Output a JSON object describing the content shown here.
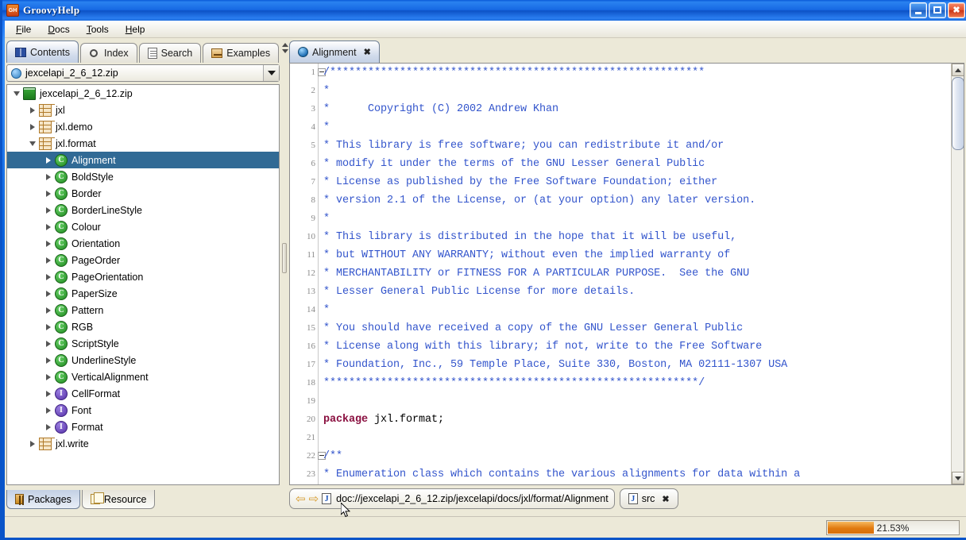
{
  "window": {
    "title": "GroovyHelp",
    "app_icon": "gh-icon",
    "minimize_label": "Minimize",
    "maximize_label": "Maximize",
    "close_label": "Close"
  },
  "menubar": {
    "items": [
      {
        "name": "file",
        "mnemonic": "F",
        "rest": "ile"
      },
      {
        "name": "docs",
        "mnemonic": "D",
        "rest": "ocs"
      },
      {
        "name": "tools",
        "mnemonic": "T",
        "rest": "ools"
      },
      {
        "name": "help",
        "mnemonic": "H",
        "rest": "elp"
      }
    ]
  },
  "left_panel": {
    "tabs": [
      {
        "label": "Contents",
        "icon": "book-icon",
        "selected": true
      },
      {
        "label": "Index",
        "icon": "magnifier-icon",
        "selected": false
      },
      {
        "label": "Search",
        "icon": "search-document-icon",
        "selected": false
      },
      {
        "label": "Examples",
        "icon": "drawer-icon",
        "selected": false
      }
    ],
    "combo": {
      "value": "jexcelapi_2_6_12.zip",
      "icon": "zip-icon"
    },
    "tree": [
      {
        "label": "jexcelapi_2_6_12.zip",
        "depth": 0,
        "icon": "archive-icon",
        "state": "expanded",
        "selected": false
      },
      {
        "label": "jxl",
        "depth": 1,
        "icon": "package-icon",
        "state": "collapsed",
        "selected": false
      },
      {
        "label": "jxl.demo",
        "depth": 1,
        "icon": "package-icon",
        "state": "collapsed",
        "selected": false
      },
      {
        "label": "jxl.format",
        "depth": 1,
        "icon": "package-icon",
        "state": "expanded",
        "selected": false
      },
      {
        "label": "Alignment",
        "depth": 2,
        "icon": "class-icon",
        "state": "collapsed",
        "selected": true
      },
      {
        "label": "BoldStyle",
        "depth": 2,
        "icon": "class-icon",
        "state": "collapsed",
        "selected": false
      },
      {
        "label": "Border",
        "depth": 2,
        "icon": "class-icon",
        "state": "collapsed",
        "selected": false
      },
      {
        "label": "BorderLineStyle",
        "depth": 2,
        "icon": "class-icon",
        "state": "collapsed",
        "selected": false
      },
      {
        "label": "Colour",
        "depth": 2,
        "icon": "class-icon",
        "state": "collapsed",
        "selected": false
      },
      {
        "label": "Orientation",
        "depth": 2,
        "icon": "class-icon",
        "state": "collapsed",
        "selected": false
      },
      {
        "label": "PageOrder",
        "depth": 2,
        "icon": "class-icon",
        "state": "collapsed",
        "selected": false
      },
      {
        "label": "PageOrientation",
        "depth": 2,
        "icon": "class-icon",
        "state": "collapsed",
        "selected": false
      },
      {
        "label": "PaperSize",
        "depth": 2,
        "icon": "class-icon",
        "state": "collapsed",
        "selected": false
      },
      {
        "label": "Pattern",
        "depth": 2,
        "icon": "class-icon",
        "state": "collapsed",
        "selected": false
      },
      {
        "label": "RGB",
        "depth": 2,
        "icon": "class-icon",
        "state": "collapsed",
        "selected": false
      },
      {
        "label": "ScriptStyle",
        "depth": 2,
        "icon": "class-icon",
        "state": "collapsed",
        "selected": false
      },
      {
        "label": "UnderlineStyle",
        "depth": 2,
        "icon": "class-icon",
        "state": "collapsed",
        "selected": false
      },
      {
        "label": "VerticalAlignment",
        "depth": 2,
        "icon": "class-icon",
        "state": "collapsed",
        "selected": false
      },
      {
        "label": "CellFormat",
        "depth": 2,
        "icon": "interface-icon",
        "state": "collapsed",
        "selected": false
      },
      {
        "label": "Font",
        "depth": 2,
        "icon": "interface-icon",
        "state": "collapsed",
        "selected": false
      },
      {
        "label": "Format",
        "depth": 2,
        "icon": "interface-icon",
        "state": "collapsed",
        "selected": false
      },
      {
        "label": "jxl.write",
        "depth": 1,
        "icon": "package-icon",
        "state": "collapsed",
        "selected": false
      }
    ],
    "bottom_tabs": [
      {
        "label": "Packages",
        "icon": "packages-icon",
        "selected": true
      },
      {
        "label": "Resource",
        "icon": "resource-icon",
        "selected": false
      }
    ]
  },
  "editor": {
    "tabs": [
      {
        "label": "Alignment",
        "icon": "globe-icon",
        "selected": true,
        "close": "✖"
      }
    ],
    "lines": [
      {
        "n": "1",
        "fold": true,
        "text": "/***********************************************************",
        "type": "comment"
      },
      {
        "n": "2",
        "fold": false,
        "text": "*",
        "type": "comment"
      },
      {
        "n": "3",
        "fold": false,
        "text": "*      Copyright (C) 2002 Andrew Khan",
        "type": "comment"
      },
      {
        "n": "4",
        "fold": false,
        "text": "*",
        "type": "comment"
      },
      {
        "n": "5",
        "fold": false,
        "text": "* This library is free software; you can redistribute it and/or",
        "type": "comment"
      },
      {
        "n": "6",
        "fold": false,
        "text": "* modify it under the terms of the GNU Lesser General Public",
        "type": "comment"
      },
      {
        "n": "7",
        "fold": false,
        "text": "* License as published by the Free Software Foundation; either",
        "type": "comment"
      },
      {
        "n": "8",
        "fold": false,
        "text": "* version 2.1 of the License, or (at your option) any later version.",
        "type": "comment"
      },
      {
        "n": "9",
        "fold": false,
        "text": "*",
        "type": "comment"
      },
      {
        "n": "10",
        "fold": false,
        "text": "* This library is distributed in the hope that it will be useful,",
        "type": "comment"
      },
      {
        "n": "11",
        "fold": false,
        "text": "* but WITHOUT ANY WARRANTY; without even the implied warranty of",
        "type": "comment"
      },
      {
        "n": "12",
        "fold": false,
        "text": "* MERCHANTABILITY or FITNESS FOR A PARTICULAR PURPOSE.  See the GNU",
        "type": "comment"
      },
      {
        "n": "13",
        "fold": false,
        "text": "* Lesser General Public License for more details.",
        "type": "comment"
      },
      {
        "n": "14",
        "fold": false,
        "text": "*",
        "type": "comment"
      },
      {
        "n": "15",
        "fold": false,
        "text": "* You should have received a copy of the GNU Lesser General Public",
        "type": "comment"
      },
      {
        "n": "16",
        "fold": false,
        "text": "* License along with this library; if not, write to the Free Software",
        "type": "comment"
      },
      {
        "n": "17",
        "fold": false,
        "text": "* Foundation, Inc., 59 Temple Place, Suite 330, Boston, MA 02111-1307 USA",
        "type": "comment"
      },
      {
        "n": "18",
        "fold": false,
        "text": "***********************************************************/",
        "type": "comment"
      },
      {
        "n": "19",
        "fold": false,
        "text": "",
        "type": "blank"
      },
      {
        "n": "20",
        "fold": false,
        "text": "package jxl.format;",
        "type": "code",
        "keyword": "package",
        "after": " jxl.format;"
      },
      {
        "n": "21",
        "fold": false,
        "text": "",
        "type": "blank"
      },
      {
        "n": "22",
        "fold": true,
        "text": "/**",
        "type": "comment"
      },
      {
        "n": "23",
        "fold": false,
        "text": "* Enumeration class which contains the various alignments for data within a",
        "type": "comment"
      }
    ],
    "scrollbar": {
      "up": "▲",
      "down": "▼"
    }
  },
  "address_bar": {
    "back_label": "⇦",
    "forward_label": "⇨",
    "icon": "java-file-icon",
    "url": "doc://jexcelapi_2_6_12.zip/jexcelapi/docs/jxl/format/Alignment",
    "src_tab": {
      "label": "src",
      "icon": "java-file-icon",
      "close": "✖"
    }
  },
  "statusbar": {
    "progress_label": "21.53%",
    "progress_value": 21.53,
    "progress_color": "#e07a10"
  },
  "colors": {
    "title_blue": "#0a54c8",
    "selection_blue": "#316a95",
    "comment_blue": "#3355cc",
    "keyword_maroon": "#8a1040",
    "accent_orange": "#e07a10"
  }
}
